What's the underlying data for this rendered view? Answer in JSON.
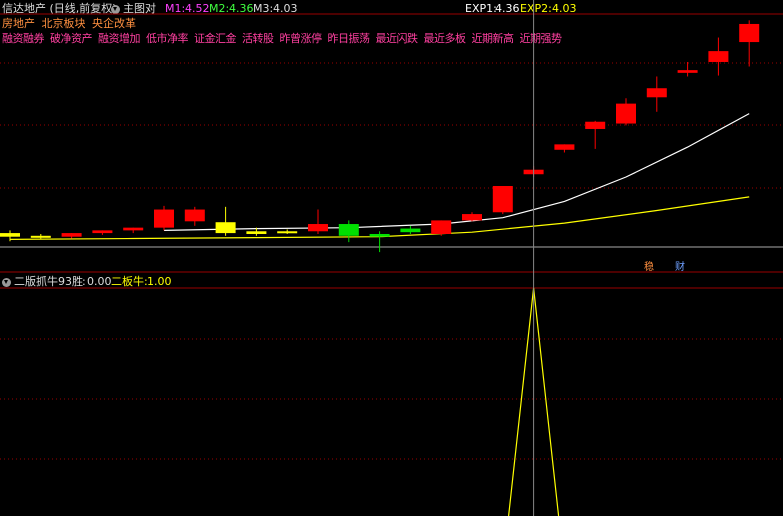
{
  "header": {
    "title": "信达地产 (日线,前复权)",
    "main_chart_label": "主图对",
    "m1_label": "M1:",
    "m1_value": "4.52",
    "m2_label": "M2:",
    "m2_value": "4.36",
    "m3_label": "M3:",
    "m3_value": "4.03",
    "exp1_label": "EXP1:",
    "exp1_value": "4.36",
    "exp2_label": "EXP2:",
    "exp2_value": "4.03"
  },
  "tags_row1": [
    "房地产",
    "北京板块",
    "央企改革"
  ],
  "tags_row2": [
    "融资融券",
    "破净资产",
    "融资增加",
    "低市净率",
    "证金汇金",
    "活转股",
    "昨曾涨停",
    "昨日振荡",
    "最近闪跌",
    "最近多板",
    "近期新高",
    "近期强势"
  ],
  "badges": {
    "b1": "稳",
    "b2": "财"
  },
  "indicator": {
    "name": "二版抓牛93胜",
    "value_sep": ":",
    "value": "0.00",
    "label2": "二板牛:",
    "value2": "1.00"
  },
  "colors": {
    "up": "#ff0000",
    "down": "#00e000",
    "flat": "#ffff00",
    "m1": "#ff40ff",
    "m2": "#40ff40",
    "m3": "#dddddd",
    "exp1": "#ffffff",
    "exp2": "#ffff00",
    "tag1": "#ff9040",
    "tag2": "#ff40a0",
    "grid": "#9a0000",
    "crosshair": "#888888",
    "indicator_line": "#ffff00"
  },
  "chart_data": {
    "type": "candlestick",
    "candles": [
      {
        "open": 3.5,
        "high": 3.53,
        "low": 3.41,
        "close": 3.46,
        "color": "flat"
      },
      {
        "open": 3.47,
        "high": 3.49,
        "low": 3.44,
        "close": 3.46,
        "color": "flat"
      },
      {
        "open": 3.46,
        "high": 3.5,
        "low": 3.44,
        "close": 3.5,
        "color": "up"
      },
      {
        "open": 3.5,
        "high": 3.53,
        "low": 3.48,
        "close": 3.53,
        "color": "up"
      },
      {
        "open": 3.53,
        "high": 3.56,
        "low": 3.5,
        "close": 3.56,
        "color": "up"
      },
      {
        "open": 3.56,
        "high": 3.8,
        "low": 3.53,
        "close": 3.76,
        "color": "up"
      },
      {
        "open": 3.76,
        "high": 3.79,
        "low": 3.58,
        "close": 3.63,
        "color": "up"
      },
      {
        "open": 3.62,
        "high": 3.79,
        "low": 3.47,
        "close": 3.5,
        "color": "flat"
      },
      {
        "open": 3.52,
        "high": 3.56,
        "low": 3.47,
        "close": 3.49,
        "color": "flat"
      },
      {
        "open": 3.52,
        "high": 3.54,
        "low": 3.49,
        "close": 3.5,
        "color": "flat"
      },
      {
        "open": 3.52,
        "high": 3.76,
        "low": 3.49,
        "close": 3.6,
        "color": "up"
      },
      {
        "open": 3.6,
        "high": 3.64,
        "low": 3.4,
        "close": 3.47,
        "color": "down"
      },
      {
        "open": 3.49,
        "high": 3.52,
        "low": 3.29,
        "close": 3.46,
        "color": "down"
      },
      {
        "open": 3.51,
        "high": 3.58,
        "low": 3.49,
        "close": 3.55,
        "color": "down"
      },
      {
        "open": 3.49,
        "high": 3.64,
        "low": 3.47,
        "close": 3.64,
        "color": "up"
      },
      {
        "open": 3.64,
        "high": 3.73,
        "low": 3.63,
        "close": 3.71,
        "color": "up"
      },
      {
        "open": 3.73,
        "high": 4.02,
        "low": 3.71,
        "close": 4.02,
        "color": "up"
      },
      {
        "open": 4.15,
        "high": 4.24,
        "low": 4.12,
        "close": 4.2,
        "color": "up"
      },
      {
        "open": 4.42,
        "high": 4.48,
        "low": 4.39,
        "close": 4.48,
        "color": "up"
      },
      {
        "open": 4.65,
        "high": 4.74,
        "low": 4.43,
        "close": 4.73,
        "color": "up"
      },
      {
        "open": 4.71,
        "high": 4.99,
        "low": 4.69,
        "close": 4.93,
        "color": "up"
      },
      {
        "open": 5.0,
        "high": 5.23,
        "low": 4.84,
        "close": 5.1,
        "color": "up"
      },
      {
        "open": 5.27,
        "high": 5.39,
        "low": 5.23,
        "close": 5.3,
        "color": "up"
      },
      {
        "open": 5.39,
        "high": 5.66,
        "low": 5.24,
        "close": 5.51,
        "color": "up"
      },
      {
        "open": 5.61,
        "high": 5.85,
        "low": 5.34,
        "close": 5.81,
        "color": "up"
      }
    ],
    "line_white": [
      [
        5,
        3.53
      ],
      [
        8,
        3.55
      ],
      [
        11,
        3.56
      ],
      [
        14,
        3.6
      ],
      [
        16,
        3.67
      ],
      [
        18,
        3.85
      ],
      [
        20,
        4.12
      ],
      [
        22,
        4.45
      ],
      [
        24,
        4.82
      ]
    ],
    "line_yellow": [
      [
        0,
        3.43
      ],
      [
        4,
        3.44
      ],
      [
        8,
        3.45
      ],
      [
        12,
        3.46
      ],
      [
        15,
        3.51
      ],
      [
        18,
        3.61
      ],
      [
        21,
        3.75
      ],
      [
        24,
        3.9
      ]
    ],
    "ylim": [
      3.28,
      5.92
    ],
    "crosshair_index": 17,
    "indicator_series": {
      "peak_index": 17,
      "value": 1.0,
      "ylim": [
        0,
        1.0
      ]
    }
  }
}
